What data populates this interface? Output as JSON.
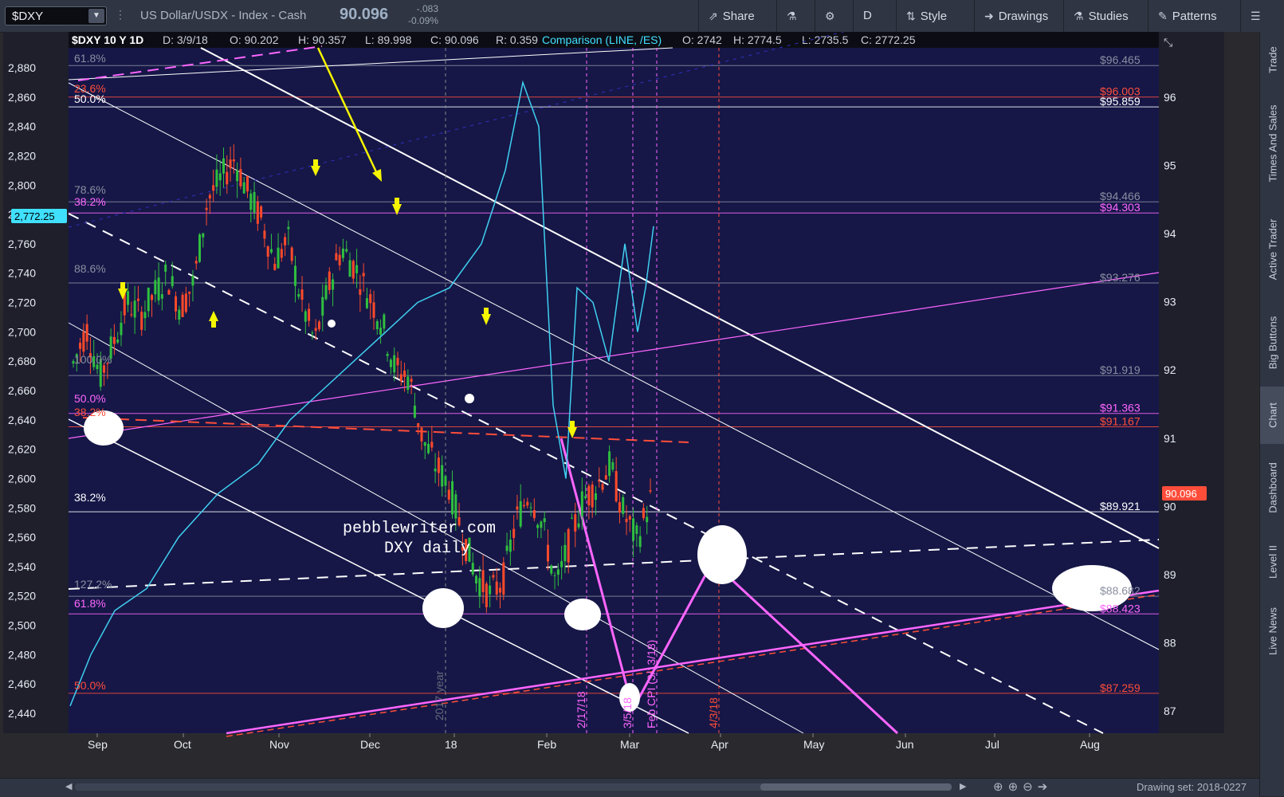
{
  "toolbar": {
    "symbol": "$DXY",
    "description": "US Dollar/USDX - Index - Cash",
    "last_price": "90.096",
    "change": "-.083",
    "change_pct": "-0.09%",
    "buttons": {
      "share": "Share",
      "period": "D",
      "style": "Style",
      "drawings": "Drawings",
      "studies": "Studies",
      "patterns": "Patterns"
    }
  },
  "header": {
    "title": "$DXY 10 Y 1D",
    "d": "D: 3/9/18",
    "o": "O: 90.202",
    "h": "H: 90.357",
    "l": "L: 89.998",
    "c": "C: 90.096",
    "r": "R: 0.359",
    "comparison": "Comparison (LINE, /ES)",
    "co": "O: 2742",
    "ch": "H: 2774.5",
    "cl": "L: 2735.5",
    "cc": "C: 2772.25"
  },
  "chart_data": {
    "type": "line",
    "title": "$DXY 10 Y 1D",
    "left_axis": {
      "ticks": [
        2880,
        2860,
        2840,
        2820,
        2800,
        2780,
        2760,
        2740,
        2720,
        2700,
        2680,
        2660,
        2640,
        2620,
        2600,
        2580,
        2560,
        2540,
        2520,
        2500,
        2480,
        2460,
        2440
      ],
      "current_label": "2,772.25"
    },
    "right_axis": {
      "ticks": [
        96,
        95,
        94,
        93,
        92,
        91,
        90,
        89,
        88,
        87
      ],
      "current_label": "90.096"
    },
    "x_ticks": [
      "Sep",
      "Oct",
      "Nov",
      "Dec",
      "18",
      "Feb",
      "Mar",
      "Apr",
      "May",
      "Jun",
      "Jul",
      "Aug"
    ],
    "levels_right": [
      {
        "label": "$96.465",
        "value": 96.465,
        "color": "#8a8fa0"
      },
      {
        "label": "$96.003",
        "value": 96.003,
        "color": "#ff4d3a"
      },
      {
        "label": "$95.859",
        "value": 95.859,
        "color": "#ffffff"
      },
      {
        "label": "$94.466",
        "value": 94.466,
        "color": "#8a8fa0"
      },
      {
        "label": "$94.303",
        "value": 94.303,
        "color": "#ff66ff"
      },
      {
        "label": "$93.276",
        "value": 93.276,
        "color": "#8a8fa0"
      },
      {
        "label": "$91.919",
        "value": 91.919,
        "color": "#8a8fa0"
      },
      {
        "label": "$91.363",
        "value": 91.363,
        "color": "#ff66ff"
      },
      {
        "label": "$91.167",
        "value": 91.167,
        "color": "#ff4d3a"
      },
      {
        "label": "$89.921",
        "value": 89.921,
        "color": "#ffffff"
      },
      {
        "label": "$88.682",
        "value": 88.682,
        "color": "#8a8fa0"
      },
      {
        "label": "$88.423",
        "value": 88.423,
        "color": "#ff66ff"
      },
      {
        "label": "$87.259",
        "value": 87.259,
        "color": "#ff4d3a"
      }
    ],
    "fib_labels": [
      "61.8%",
      "23.6%",
      "50.0%",
      "78.6%",
      "38.2%",
      "88.6%",
      "100.0%",
      "50.0%",
      "38.2%",
      "38.2%",
      "127.2%",
      "61.8%",
      "50.0%"
    ],
    "comparison_series": {
      "name": "/ES",
      "values": [
        2445,
        2480,
        2510,
        2525,
        2560,
        2590,
        2610,
        2640,
        2660,
        2680,
        2700,
        2720,
        2730,
        2760,
        2810,
        2870,
        2840,
        2650,
        2600,
        2730,
        2720,
        2680,
        2760,
        2700,
        2730,
        2772
      ]
    },
    "annotations": [
      "pebblewriter.com",
      "DXY daily",
      "2017 year",
      "2/17/18",
      "3/5/18",
      "Feb CPI (3/13/18)",
      "4/3/18"
    ]
  },
  "watermark": {
    "line1": "pebblewriter.com",
    "line2": "DXY daily"
  },
  "vlabels": {
    "year": "2017 year",
    "d1": "2/17/18",
    "d2": "3/5/18",
    "cpi": "Feb CPI (3/13/18)",
    "d3": "4/3/18"
  },
  "right_rail": [
    "Trade",
    "Times And Sales",
    "Active Trader",
    "Big Buttons",
    "Chart",
    "Dashboard",
    "Level II",
    "Live News"
  ],
  "bottom": {
    "drawing_set": "Drawing set: 2018-0227"
  }
}
